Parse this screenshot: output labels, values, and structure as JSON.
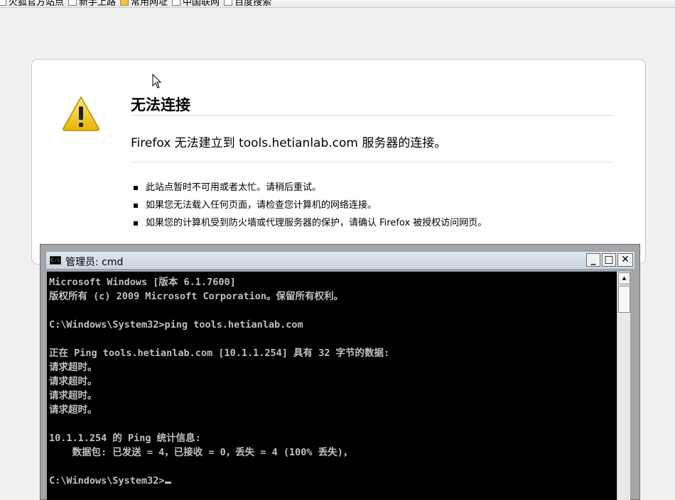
{
  "bookmarks_bar": {
    "items": [
      {
        "label": "火狐官方站点",
        "icon": "page-icon"
      },
      {
        "label": "新手上路",
        "icon": "page-icon"
      },
      {
        "label": "常用网址",
        "icon": "folder-icon"
      },
      {
        "label": "中国联网",
        "icon": "page-icon"
      },
      {
        "label": "百度搜索",
        "icon": "page-icon"
      }
    ]
  },
  "error_page": {
    "title": "无法连接",
    "subtitle": "Firefox 无法建立到 tools.hetianlab.com 服务器的连接。",
    "bullets": [
      "此站点暂时不可用或者太忙。请稍后重试。",
      "如果您无法载入任何页面，请检查您计算机的网络连接。",
      "如果您的计算机受到防火墙或代理服务器的保护，请确认 Firefox 被授权访问网页。"
    ],
    "icon": "warning-icon",
    "accent": "#f2c200"
  },
  "cmd_window": {
    "title": "管理员: cmd",
    "buttons": {
      "minimize": "_",
      "maximize": "□",
      "close": "✕"
    },
    "lines": [
      "Microsoft Windows [版本 6.1.7600]",
      "版权所有 (c) 2009 Microsoft Corporation。保留所有权利。",
      "",
      "C:\\Windows\\System32>ping tools.hetianlab.com",
      "",
      "正在 Ping tools.hetianlab.com [10.1.1.254] 具有 32 字节的数据:",
      "请求超时。",
      "请求超时。",
      "请求超时。",
      "请求超时。",
      "",
      "10.1.1.254 的 Ping 统计信息:",
      "    数据包: 已发送 = 4，已接收 = 0，丢失 = 4 (100% 丢失)，",
      ""
    ],
    "prompt": "C:\\Windows\\System32>",
    "background": "#000000",
    "text_color": "#c0c0c0"
  }
}
